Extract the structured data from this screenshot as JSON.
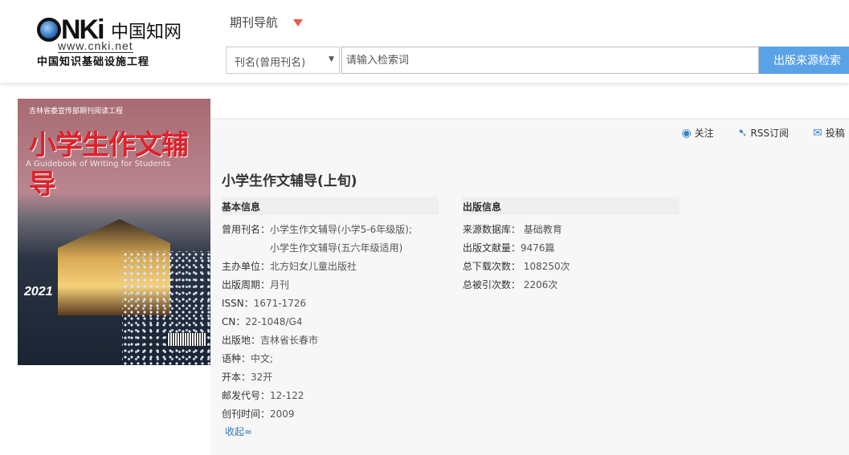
{
  "header": {
    "logo": {
      "brand": "CNKI",
      "zh": "中国知网",
      "url": "www.cnki.net",
      "subtitle": "中国知识基础设施工程"
    },
    "nav_title": "期刊导航",
    "search": {
      "field_selected": "刊名(曾用刊名)",
      "placeholder": "请输入检索词",
      "value": "",
      "button": "出版来源检索"
    }
  },
  "cover": {
    "top": "吉林省委宣传部期刊阅读工程",
    "title": "小学生作文辅导",
    "subtitle_en": "A Guidebook of Writing for Students",
    "year": "2021"
  },
  "actions": [
    {
      "icon": "eye-icon",
      "label": "关注"
    },
    {
      "icon": "rss-icon",
      "label": "RSS订阅"
    },
    {
      "icon": "mail-icon",
      "label": "投稿"
    }
  ],
  "journal_title": "小学生作文辅导(上旬)",
  "basic_info": {
    "heading": "基本信息",
    "former_names_label": "曾用刊名：",
    "former_names": [
      "小学生作文辅导(小学5-6年级版);",
      "小学生作文辅导(五六年级适用)"
    ],
    "rows": [
      {
        "label": "主办单位：",
        "value": "北方妇女儿童出版社"
      },
      {
        "label": "出版周期：",
        "value": "月刊"
      },
      {
        "label": "ISSN：",
        "value": "1671-1726"
      },
      {
        "label": "CN：",
        "value": "22-1048/G4"
      },
      {
        "label": "出版地：",
        "value": "吉林省长春市"
      },
      {
        "label": "语种：",
        "value": "中文;"
      },
      {
        "label": "开本：",
        "value": "32开"
      },
      {
        "label": "邮发代号：",
        "value": "12-122"
      },
      {
        "label": "创刊时间：",
        "value": "2009"
      }
    ],
    "collapse": "收起≈"
  },
  "publish_info": {
    "heading": "出版信息",
    "rows": [
      {
        "label": "来源数据库：",
        "value": " 基础教育"
      },
      {
        "label": "出版文献量：",
        "value": "9476篇"
      },
      {
        "label": "总下载次数：",
        "value": " 108250次"
      },
      {
        "label": "总被引次数：",
        "value": " 2206次"
      }
    ]
  }
}
